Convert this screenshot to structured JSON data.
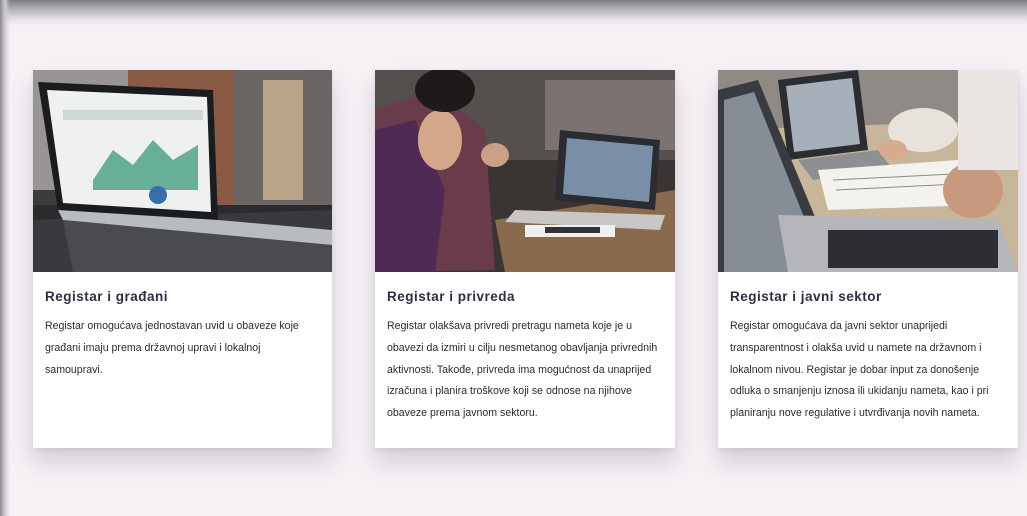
{
  "cards": [
    {
      "title": "Registar i građani",
      "text": "Registar omogućava jednostavan uvid u obaveze koje građani imaju prema državnoj upravi i lokalnoj samoupravi.",
      "image_icon": "laptop-dashboard-photo"
    },
    {
      "title": "Registar i privreda",
      "text": "Registar olakšava privredi pretragu nameta koje je u obavezi da izmiri u cilju nesmetanog obavljanja privrednih aktivnosti. Takođe, privreda ima mogućnost da unaprijed izračuna i planira troškove koji se odnose na njihove obaveze prema javnom sektoru.",
      "image_icon": "business-meeting-photo"
    },
    {
      "title": "Registar i javni sektor",
      "text": "Registar omogućava da javni sektor unaprijedi transparentnost i olakša uvid u namete na državnom i lokalnom nivou. Registar je dobar input za donošenje odluka o smanjenju iznosa ili ukidanju nameta, kao i pri planiranju nove regulative i utvrđivanja novih nameta.",
      "image_icon": "laptop-paperwork-photo"
    }
  ],
  "colors": {
    "page_background": "#f5f1f5",
    "card_background": "#ffffff",
    "title": "#2c2f44",
    "text": "#2b2b2b"
  }
}
